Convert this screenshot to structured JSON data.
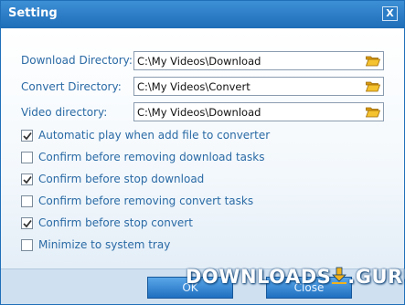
{
  "dialog": {
    "title": "Setting",
    "close_glyph": "X"
  },
  "directories": [
    {
      "label": "Download Directory:",
      "value": "C:\\My Videos\\Download",
      "icon": "folder-icon"
    },
    {
      "label": "Convert Directory:",
      "value": "C:\\My Videos\\Convert",
      "icon": "folder-icon"
    },
    {
      "label": "Video directory:",
      "value": "C:\\My Videos\\Download",
      "icon": "folder-icon"
    }
  ],
  "options": [
    {
      "label": "Automatic play when add file to converter",
      "checked": true
    },
    {
      "label": "Confirm before removing download tasks",
      "checked": false
    },
    {
      "label": "Confirm before stop download",
      "checked": true
    },
    {
      "label": "Confirm before removing convert tasks",
      "checked": false
    },
    {
      "label": "Confirm before stop convert",
      "checked": true
    },
    {
      "label": "Minimize to system tray",
      "checked": false
    }
  ],
  "buttons": {
    "ok_label": "OK",
    "close_label": "Close"
  },
  "watermark": {
    "left": "DOWNLOADS",
    "right": ".GURU"
  },
  "colors": {
    "title_bar": "#2a7cc6",
    "label_text": "#2a6aa5",
    "button": "#1e6fc0",
    "folder": "#f2b21c"
  }
}
